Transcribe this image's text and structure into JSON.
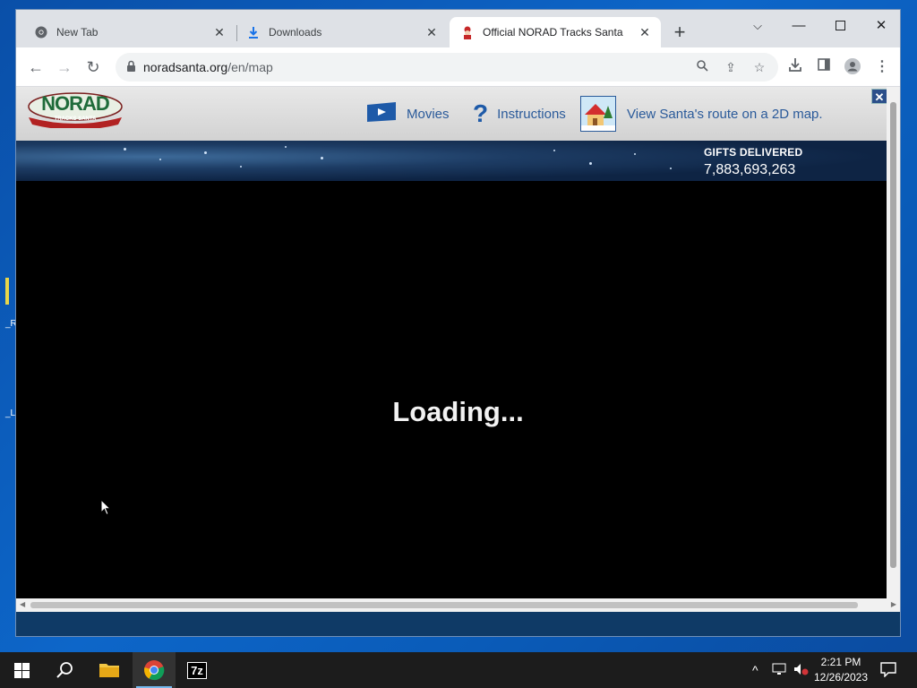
{
  "desktop": {
    "icon_label_1": "_R",
    "icon_label_2": "_L"
  },
  "browser": {
    "tabs": [
      {
        "title": "New Tab",
        "favicon": "chrome-icon"
      },
      {
        "title": "Downloads",
        "favicon": "download-icon"
      },
      {
        "title": "Official NORAD Tracks Santa",
        "favicon": "santa-icon",
        "active": true
      }
    ],
    "url_host": "noradsanta.org",
    "url_path": "/en/map"
  },
  "page": {
    "logo_text_top": "NORAD",
    "logo_text_bottom": "TRACKS SANTA",
    "nav": {
      "movies": "Movies",
      "instructions": "Instructions",
      "map2d": "View Santa's route on a 2D map."
    },
    "gifts_label": "GIFTS DELIVERED",
    "gifts_count": "7,883,693,263",
    "loading_text": "Loading..."
  },
  "taskbar": {
    "time": "2:21 PM",
    "date": "12/26/2023",
    "items": [
      "start",
      "search",
      "file-explorer",
      "chrome",
      "7zip"
    ],
    "sevenzip_label": "7z"
  },
  "colors": {
    "accent": "#1a73e8",
    "nav_text": "#2a5a9a",
    "banner": "#1d3c64"
  }
}
